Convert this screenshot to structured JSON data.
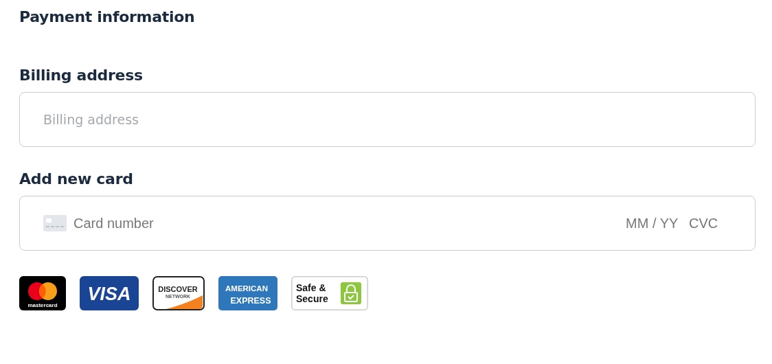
{
  "title": "Payment information",
  "billing": {
    "label": "Billing address",
    "placeholder": "Billing address"
  },
  "card": {
    "label": "Add new card",
    "number_placeholder": "Card number",
    "expiry_placeholder": "MM / YY",
    "cvc_placeholder": "CVC"
  },
  "badges": [
    {
      "kind": "mastercard",
      "lines": [
        "mastercard"
      ]
    },
    {
      "kind": "visa",
      "lines": [
        "VISA"
      ]
    },
    {
      "kind": "discover",
      "lines": [
        "DISCOVER",
        "NETWORK"
      ]
    },
    {
      "kind": "amex",
      "lines": [
        "AMERICAN",
        "EXPRESS"
      ]
    },
    {
      "kind": "secure",
      "lines": [
        "Safe &",
        "Secure"
      ]
    }
  ]
}
